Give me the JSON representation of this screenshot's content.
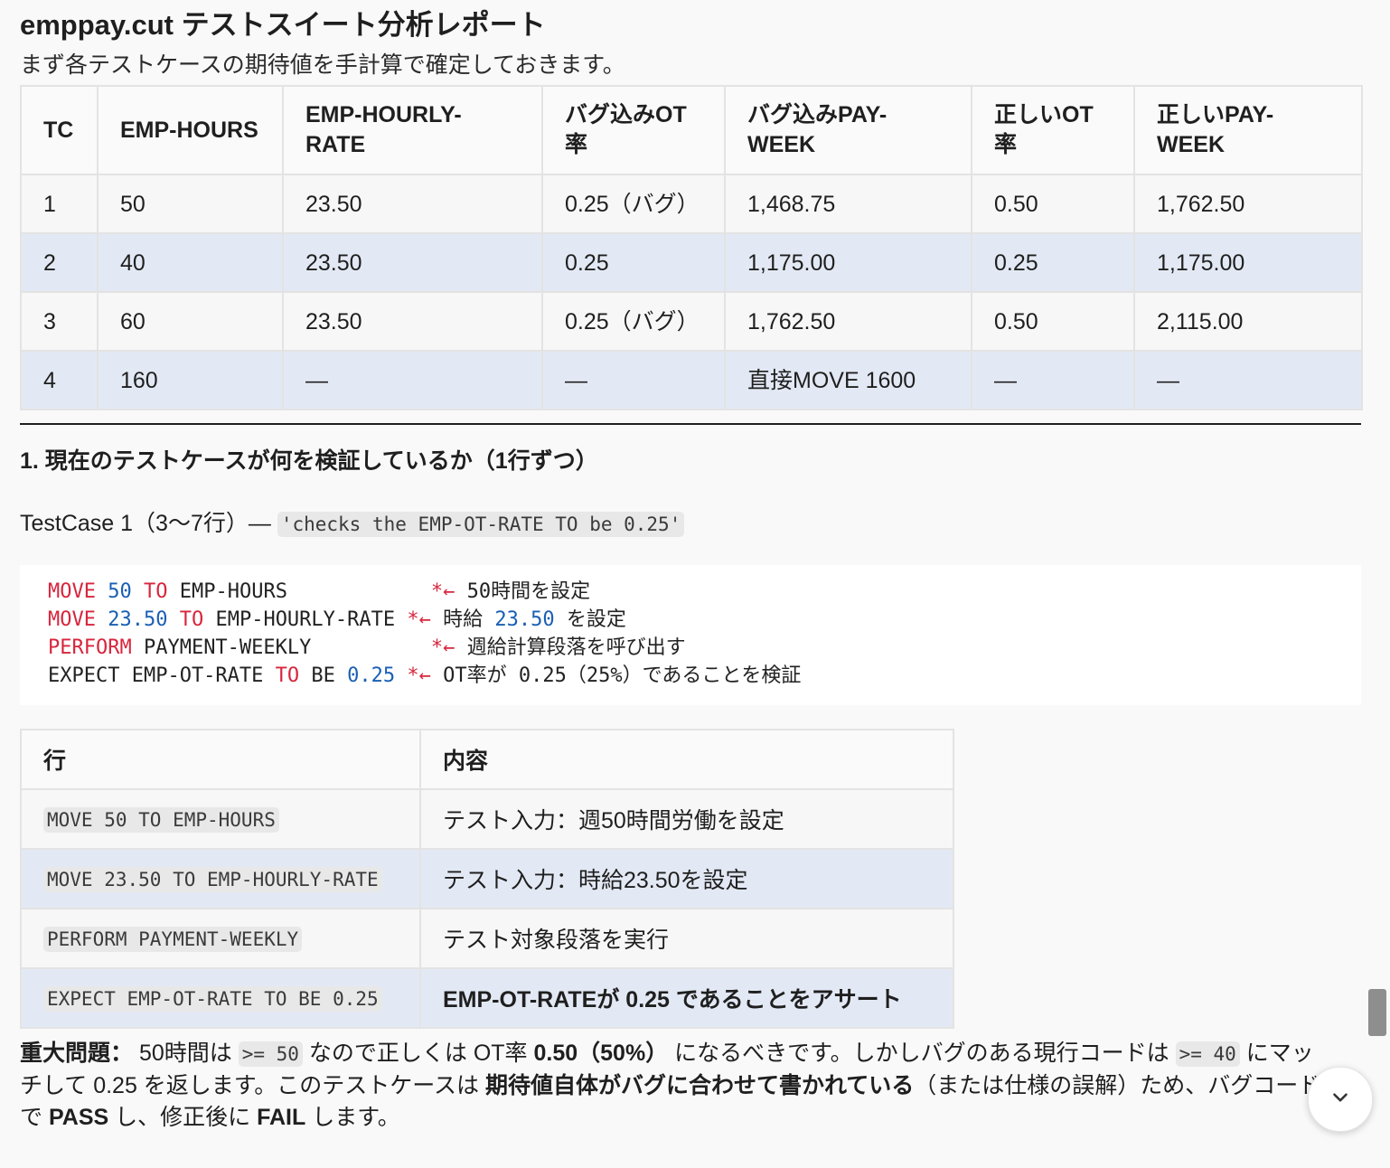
{
  "title": "emppay.cut テストスイート分析レポート",
  "intro": "まず各テストケースの期待値を手計算で確定しておきます。",
  "table1": {
    "headers": [
      "TC",
      "EMP-HOURS",
      "EMP-HOURLY-RATE",
      "バグ込みOT率",
      "バグ込みPAY-WEEK",
      "正しいOT率",
      "正しいPAY-WEEK"
    ],
    "rows": [
      [
        "1",
        "50",
        "23.50",
        "0.25（バグ）",
        "1,468.75",
        "0.50",
        "1,762.50"
      ],
      [
        "2",
        "40",
        "23.50",
        "0.25",
        "1,175.00",
        "0.25",
        "1,175.00"
      ],
      [
        "3",
        "60",
        "23.50",
        "0.25（バグ）",
        "1,762.50",
        "0.50",
        "2,115.00"
      ],
      [
        "4",
        "160",
        "—",
        "—",
        "直接MOVE 1600",
        "—",
        "—"
      ]
    ]
  },
  "section1": {
    "heading": "1. 現在のテストケースが何を検証しているか（1行ずつ）",
    "testcase_label": "TestCase 1（3〜7行）—",
    "testcase_code": "'checks the EMP-OT-RATE TO be 0.25'",
    "code_lines": [
      {
        "parts": [
          [
            "kw",
            "MOVE"
          ],
          [
            "t",
            " "
          ],
          [
            "num",
            "50"
          ],
          [
            "t",
            " "
          ],
          [
            "kw",
            "TO"
          ],
          [
            "t",
            " EMP-HOURS            "
          ],
          [
            "cm",
            "*←"
          ],
          [
            "t",
            " 50時間を設定"
          ]
        ]
      },
      {
        "parts": [
          [
            "kw",
            "MOVE"
          ],
          [
            "t",
            " "
          ],
          [
            "num",
            "23.50"
          ],
          [
            "t",
            " "
          ],
          [
            "kw",
            "TO"
          ],
          [
            "t",
            " EMP-HOURLY-RATE "
          ],
          [
            "cm",
            "*←"
          ],
          [
            "t",
            " 時給 "
          ],
          [
            "num",
            "23.50"
          ],
          [
            "t",
            " を設定"
          ]
        ]
      },
      {
        "parts": [
          [
            "kw",
            "PERFORM"
          ],
          [
            "t",
            " PAYMENT-WEEKLY          "
          ],
          [
            "cm",
            "*←"
          ],
          [
            "t",
            " 週給計算段落を呼び出す"
          ]
        ]
      },
      {
        "parts": [
          [
            "t",
            "EXPECT EMP-OT-RATE "
          ],
          [
            "kw",
            "TO"
          ],
          [
            "t",
            " BE "
          ],
          [
            "num",
            "0.25"
          ],
          [
            "t",
            " "
          ],
          [
            "cm",
            "*←"
          ],
          [
            "t",
            " OT率が 0.25（25%）であることを検証"
          ]
        ]
      }
    ]
  },
  "table2": {
    "headers": [
      "行",
      "内容"
    ],
    "rows": [
      {
        "code": "MOVE 50 TO EMP-HOURS",
        "desc": "テスト入力：週50時間労働を設定"
      },
      {
        "code": "MOVE 23.50 TO EMP-HOURLY-RATE",
        "desc": "テスト入力：時給23.50を設定"
      },
      {
        "code": "PERFORM PAYMENT-WEEKLY",
        "desc": "テスト対象段落を実行"
      },
      {
        "code": "EXPECT EMP-OT-RATE TO BE 0.25",
        "desc": "EMP-OT-RATEが 0.25 であることをアサート"
      }
    ]
  },
  "warning": {
    "label": "重大問題：",
    "t1": " 50時間は ",
    "c1": ">= 50",
    "t2": " なので正しくは OT率 ",
    "b1": "0.50（50%）",
    "t3": " になるべきです。しかしバグのある現行コードは ",
    "c2": ">= 40",
    "t4": " にマッチして 0.25 を返します。このテストケースは ",
    "b2": "期待値自体がバグに合わせて書かれている",
    "t5": "（または仕様の誤解）ため、バグコードで ",
    "b3": "PASS",
    "t6": " し、修正後に ",
    "b4": "FAIL",
    "t7": " します。"
  },
  "scroll_button": {
    "icon": "chevron-down-icon"
  }
}
